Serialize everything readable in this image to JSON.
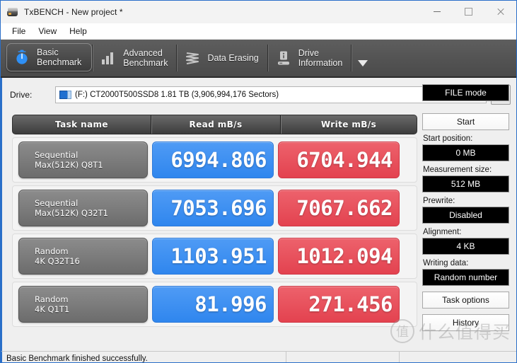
{
  "window": {
    "title": "TxBENCH - New project *",
    "app_icon": "disk-drive-icon",
    "minimize_label": "—",
    "maximize_label": "▢",
    "close_label": "✕"
  },
  "menubar": {
    "items": [
      {
        "label": "File"
      },
      {
        "label": "View"
      },
      {
        "label": "Help"
      }
    ]
  },
  "tabs": {
    "items": [
      {
        "label": "Basic\nBenchmark",
        "icon": "stopwatch-icon",
        "active": true
      },
      {
        "label": "Advanced\nBenchmark",
        "icon": "bar-chart-icon",
        "active": false
      },
      {
        "label": "Data Erasing",
        "icon": "shred-icon",
        "active": false
      },
      {
        "label": "Drive\nInformation",
        "icon": "drive-info-icon",
        "active": false
      }
    ],
    "overflow_icon": "chevron-down-icon"
  },
  "drive": {
    "label": "Drive:",
    "selected": "(F:) CT2000T500SSD8  1.81 TB (3,906,994,176 Sectors)",
    "icon": "drive-icon",
    "refresh_icon": "refresh-icon"
  },
  "results": {
    "columns": [
      "Task name",
      "Read mB/s",
      "Write mB/s"
    ],
    "rows": [
      {
        "task_line1": "Sequential",
        "task_line2": "Max(512K) Q8T1",
        "read": "6994.806",
        "write": "6704.944"
      },
      {
        "task_line1": "Sequential",
        "task_line2": "Max(512K) Q32T1",
        "read": "7053.696",
        "write": "7067.662"
      },
      {
        "task_line1": "Random",
        "task_line2": "4K Q32T16",
        "read": "1103.951",
        "write": "1012.094"
      },
      {
        "task_line1": "Random",
        "task_line2": "4K Q1T1",
        "read": "81.996",
        "write": "271.456"
      }
    ]
  },
  "sidepanel": {
    "mode_button": "FILE mode",
    "start_button": "Start",
    "start_position_label": "Start position:",
    "start_position_value": "0 MB",
    "measurement_size_label": "Measurement size:",
    "measurement_size_value": "512 MB",
    "prewrite_label": "Prewrite:",
    "prewrite_value": "Disabled",
    "alignment_label": "Alignment:",
    "alignment_value": "4 KB",
    "writing_data_label": "Writing data:",
    "writing_data_value": "Random number",
    "task_options_button": "Task options",
    "history_button": "History"
  },
  "statusbar": {
    "message": "Basic Benchmark finished successfully.",
    "pane2": "",
    "pane3": ""
  },
  "watermark": {
    "mark": "值",
    "text": "什么值得买"
  },
  "colors": {
    "read_chip": "#2f86ee",
    "write_chip": "#e3424f",
    "tab_strip": "#4a4a4a",
    "accent_border": "#2a6fc9"
  }
}
